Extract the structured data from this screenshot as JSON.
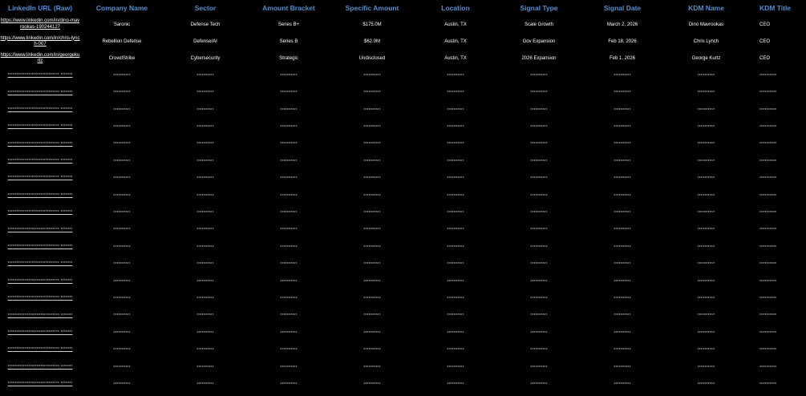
{
  "table": {
    "headers": [
      "LinkedIn URL (Raw)",
      "Company Name",
      "Sector",
      "Amount Bracket",
      "Specific Amount",
      "Location",
      "Signal Type",
      "Signal Date",
      "KDM Name",
      "KDM Title"
    ],
    "rows": [
      {
        "url": "https://www.linkedin.com/in/dino-mavrookas-190244127",
        "company": "Saronic",
        "sector": "Defense Tech",
        "bracket": "Series B+",
        "amount": "$175.0M",
        "location": "Austin, TX",
        "signal": "Scale Growth",
        "date": "March 2, 2026",
        "kdm": "Dino Mavrookas",
        "title": "CEO"
      },
      {
        "url": "https://www.linkedin.com/in/chris-lynch-007",
        "company": "Rebellion Defense",
        "sector": "Defense/AI",
        "bracket": "Series B",
        "amount": "$62.0M",
        "location": "Austin, TX",
        "signal": "Gov Expansion",
        "date": "Feb 18, 2026",
        "kdm": "Chris Lynch",
        "title": "CEO"
      },
      {
        "url": "https://www.linkedin.com/in/georgekurtz",
        "company": "CrowdStrike",
        "sector": "Cybersecurity",
        "bracket": "Strategic",
        "amount": "Undisclosed",
        "location": "Austin, TX",
        "signal": "2026 Expansion",
        "date": "Feb 1, 2026",
        "kdm": "George Kurtz",
        "title": "CEO"
      }
    ],
    "masked_rows": [
      {
        "url": "****************************** *******",
        "company": "**********",
        "sector": "**********",
        "bracket": "**********",
        "amount": "**********",
        "location": "**********",
        "signal": "**********",
        "date": "**********",
        "kdm": "**********",
        "title": "**********"
      },
      {
        "url": "****************************** *******",
        "company": "**********",
        "sector": "**********",
        "bracket": "**********",
        "amount": "**********",
        "location": "**********",
        "signal": "**********",
        "date": "**********",
        "kdm": "**********",
        "title": "**********"
      },
      {
        "url": "****************************** *******",
        "company": "**********",
        "sector": "**********",
        "bracket": "**********",
        "amount": "**********",
        "location": "**********",
        "signal": "**********",
        "date": "**********",
        "kdm": "**********",
        "title": "**********"
      },
      {
        "url": "****************************** *******",
        "company": "**********",
        "sector": "**********",
        "bracket": "**********",
        "amount": "**********",
        "location": "**********",
        "signal": "**********",
        "date": "**********",
        "kdm": "**********",
        "title": "**********"
      },
      {
        "url": "****************************** *******",
        "company": "**********",
        "sector": "**********",
        "bracket": "**********",
        "amount": "**********",
        "location": "**********",
        "signal": "**********",
        "date": "**********",
        "kdm": "**********",
        "title": "**********"
      },
      {
        "url": "****************************** *******",
        "company": "**********",
        "sector": "**********",
        "bracket": "**********",
        "amount": "**********",
        "location": "**********",
        "signal": "**********",
        "date": "**********",
        "kdm": "**********",
        "title": "**********"
      },
      {
        "url": "****************************** *******",
        "company": "**********",
        "sector": "**********",
        "bracket": "**********",
        "amount": "**********",
        "location": "**********",
        "signal": "**********",
        "date": "**********",
        "kdm": "**********",
        "title": "**********"
      },
      {
        "url": "****************************** *******",
        "company": "**********",
        "sector": "**********",
        "bracket": "**********",
        "amount": "**********",
        "location": "**********",
        "signal": "**********",
        "date": "**********",
        "kdm": "**********",
        "title": "**********"
      },
      {
        "url": "****************************** *******",
        "company": "**********",
        "sector": "**********",
        "bracket": "**********",
        "amount": "**********",
        "location": "**********",
        "signal": "**********",
        "date": "**********",
        "kdm": "**********",
        "title": "**********"
      },
      {
        "url": "****************************** *******",
        "company": "**********",
        "sector": "**********",
        "bracket": "**********",
        "amount": "**********",
        "location": "**********",
        "signal": "**********",
        "date": "**********",
        "kdm": "**********",
        "title": "**********"
      },
      {
        "url": "****************************** *******",
        "company": "**********",
        "sector": "**********",
        "bracket": "**********",
        "amount": "**********",
        "location": "**********",
        "signal": "**********",
        "date": "**********",
        "kdm": "**********",
        "title": "**********"
      },
      {
        "url": "****************************** *******",
        "company": "**********",
        "sector": "**********",
        "bracket": "**********",
        "amount": "**********",
        "location": "**********",
        "signal": "**********",
        "date": "**********",
        "kdm": "**********",
        "title": "**********"
      },
      {
        "url": "****************************** *******",
        "company": "**********",
        "sector": "**********",
        "bracket": "**********",
        "amount": "**********",
        "location": "**********",
        "signal": "**********",
        "date": "**********",
        "kdm": "**********",
        "title": "**********"
      },
      {
        "url": "****************************** *******",
        "company": "**********",
        "sector": "**********",
        "bracket": "**********",
        "amount": "**********",
        "location": "**********",
        "signal": "**********",
        "date": "**********",
        "kdm": "**********",
        "title": "**********"
      },
      {
        "url": "****************************** *******",
        "company": "**********",
        "sector": "**********",
        "bracket": "**********",
        "amount": "**********",
        "location": "**********",
        "signal": "**********",
        "date": "**********",
        "kdm": "**********",
        "title": "**********"
      },
      {
        "url": "****************************** *******",
        "company": "**********",
        "sector": "**********",
        "bracket": "**********",
        "amount": "**********",
        "location": "**********",
        "signal": "**********",
        "date": "**********",
        "kdm": "**********",
        "title": "**********"
      },
      {
        "url": "****************************** *******",
        "company": "**********",
        "sector": "**********",
        "bracket": "**********",
        "amount": "**********",
        "location": "**********",
        "signal": "**********",
        "date": "**********",
        "kdm": "**********",
        "title": "**********"
      },
      {
        "url": "****************************** *******",
        "company": "**********",
        "sector": "**********",
        "bracket": "**********",
        "amount": "**********",
        "location": "**********",
        "signal": "**********",
        "date": "**********",
        "kdm": "**********",
        "title": "**********"
      },
      {
        "url": "****************************** *******",
        "company": "**********",
        "sector": "**********",
        "bracket": "**********",
        "amount": "**********",
        "location": "**********",
        "signal": "**********",
        "date": "**********",
        "kdm": "**********",
        "title": "**********"
      }
    ]
  },
  "colors": {
    "background": "#000000",
    "header_text": "#4f8fd0",
    "cell_text": "#ffffff"
  }
}
